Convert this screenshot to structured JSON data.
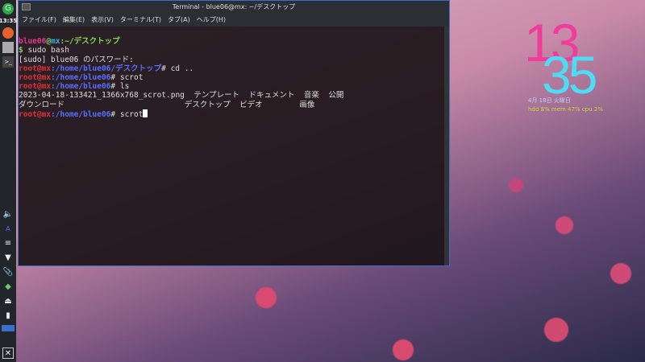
{
  "panel": {
    "clock": "13:35",
    "icons": [
      "mx-logo-icon",
      "firefox-icon",
      "file-manager-icon",
      "terminal-icon",
      "volume-icon",
      "keyboard-layout-icon",
      "notes-icon",
      "network-icon",
      "clipboard-icon",
      "updater-icon",
      "eject-icon",
      "battery-icon",
      "workspace-pager",
      "logout-icon"
    ]
  },
  "window": {
    "title": "Terminal - blue06@mx: ~/デスクトップ",
    "menu": [
      "ファイル(F)",
      "編集(E)",
      "表示(V)",
      "ターミナル(T)",
      "タブ(A)",
      "ヘルプ(H)"
    ]
  },
  "terminal": {
    "l1": {
      "user": "blue06",
      "at": "@",
      "host": "mx",
      "path": ":~/デスクトップ"
    },
    "l2": "$ sudo bash",
    "l3": "[sudo] blue06 のパスワード:",
    "l4": {
      "user": "root@mx",
      "path": ":/home/blue06/デスクトップ",
      "cmd": "# cd .."
    },
    "l5": {
      "user": "root@mx",
      "path": ":/home/blue06",
      "cmd": "# scrot"
    },
    "l6": {
      "user": "root@mx",
      "path": ":/home/blue06",
      "cmd": "# ls"
    },
    "l7": "2023-04-18-133421_1366x768_scrot.png  テンプレート  ドキュメント  音楽  公開",
    "l8": "ダウンロード                          デスクトップ  ビデオ        画像",
    "l9": {
      "user": "root@mx",
      "path": ":/home/blue06",
      "cmd": "# scrot"
    }
  },
  "conky": {
    "hour": "13",
    "minute": "35",
    "date": "4月 18日 火曜日",
    "stats": "hdd 8% mem 47% cpu  2%"
  }
}
